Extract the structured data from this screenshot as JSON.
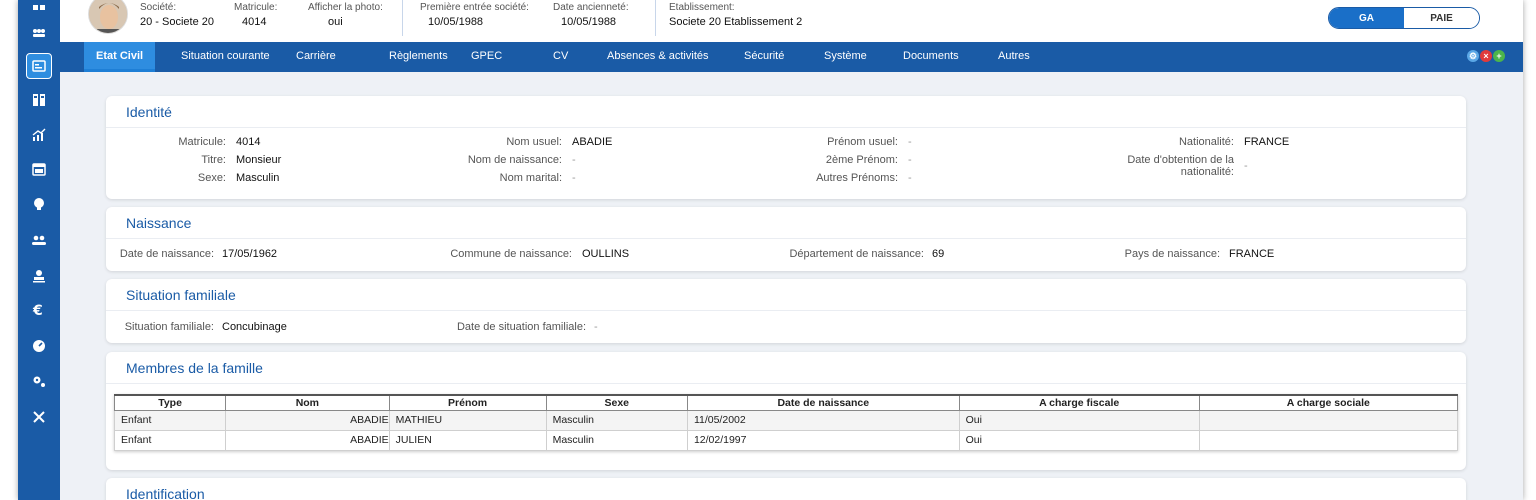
{
  "header": {
    "societe_label": "Société:",
    "societe_value": "20 - Societe 20",
    "matricule_label": "Matricule:",
    "matricule_value": "4014",
    "photo_label": "Afficher la photo:",
    "photo_value": "oui",
    "premiere_label": "Première entrée société:",
    "premiere_value": "10/05/1988",
    "anciennete_label": "Date ancienneté:",
    "anciennete_value": "10/05/1988",
    "etab_label": "Etablissement:",
    "etab_value": "Societe 20 Etablissement 2",
    "toggle_ga": "GA",
    "toggle_paie": "PAIE"
  },
  "tabs": [
    "Etat Civil",
    "Situation courante",
    "Carrière",
    "Règlements",
    "GPEC",
    "CV",
    "Absences & activités",
    "Sécurité",
    "Système",
    "Documents",
    "Autres"
  ],
  "identite": {
    "title": "Identité",
    "matricule_label": "Matricule:",
    "matricule": "4014",
    "titre_label": "Titre:",
    "titre": "Monsieur",
    "sexe_label": "Sexe:",
    "sexe": "Masculin",
    "nom_usuel_label": "Nom usuel:",
    "nom_usuel": "ABADIE",
    "nom_naissance_label": "Nom de naissance:",
    "nom_marital_label": "Nom marital:",
    "prenom_usuel_label": "Prénom usuel:",
    "prenom2_label": "2ème Prénom:",
    "autres_prenoms_label": "Autres Prénoms:",
    "nationalite_label": "Nationalité:",
    "nationalite": "FRANCE",
    "date_nat_label_1": "Date d'obtention de la",
    "date_nat_label_2": "nationalité:",
    "empty": "-"
  },
  "naissance": {
    "title": "Naissance",
    "date_label": "Date de naissance:",
    "date": "17/05/1962",
    "commune_label": "Commune de naissance:",
    "commune": "OULLINS",
    "dept_label": "Département de naissance:",
    "dept": "69",
    "pays_label": "Pays de naissance:",
    "pays": "FRANCE"
  },
  "familiale": {
    "title": "Situation familiale",
    "situation_label": "Situation familiale:",
    "situation": "Concubinage",
    "date_label": "Date de situation familiale:",
    "empty": "-"
  },
  "membres": {
    "title": "Membres de la famille",
    "columns": [
      "Type",
      "Nom",
      "Prénom",
      "Sexe",
      "Date de naissance",
      "A charge fiscale",
      "A charge sociale"
    ],
    "rows": [
      [
        "Enfant",
        "ABADIE",
        "MATHIEU",
        "Masculin",
        "11/05/2002",
        "Oui",
        ""
      ],
      [
        "Enfant",
        "ABADIE",
        "JULIEN",
        "Masculin",
        "12/02/1997",
        "Oui",
        ""
      ]
    ]
  },
  "identification": {
    "title": "Identification"
  },
  "colors": {
    "primary": "#1a5ba6",
    "accent": "#2e8de0",
    "title": "#1a5ba6"
  },
  "sidebar_icons": [
    "users-icon",
    "id-card-icon",
    "org-chart-icon",
    "chart-icon",
    "calendar-icon",
    "lightbulb-icon",
    "group-icon",
    "stamp-icon",
    "euro-icon",
    "gauge-icon",
    "gears-icon",
    "tools-icon"
  ]
}
